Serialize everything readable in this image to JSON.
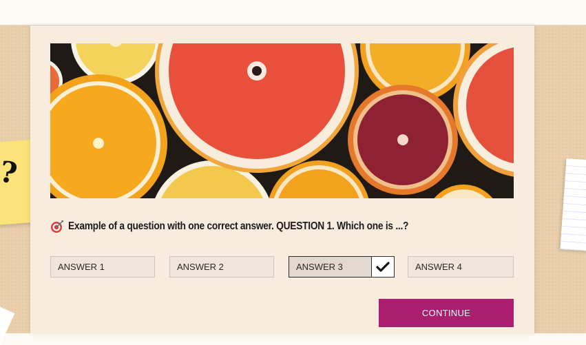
{
  "question": {
    "icon": "target-icon",
    "text": "Example of a question with one correct answer. QUESTION 1. Which one is ...?"
  },
  "answers": [
    {
      "label": "ANSWER 1",
      "selected": false
    },
    {
      "label": "ANSWER 2",
      "selected": false
    },
    {
      "label": "ANSWER 3",
      "selected": true
    },
    {
      "label": "ANSWER 4",
      "selected": false
    }
  ],
  "continue_label": "CONTINUE",
  "banner": {
    "subject": "sliced citrus fruits"
  },
  "sticky_note_mark": "?",
  "colors": {
    "accent": "#ab1e6f",
    "board": "#e9cfab",
    "card": "#f8ecdf",
    "sticky_note": "#fbe37a"
  }
}
